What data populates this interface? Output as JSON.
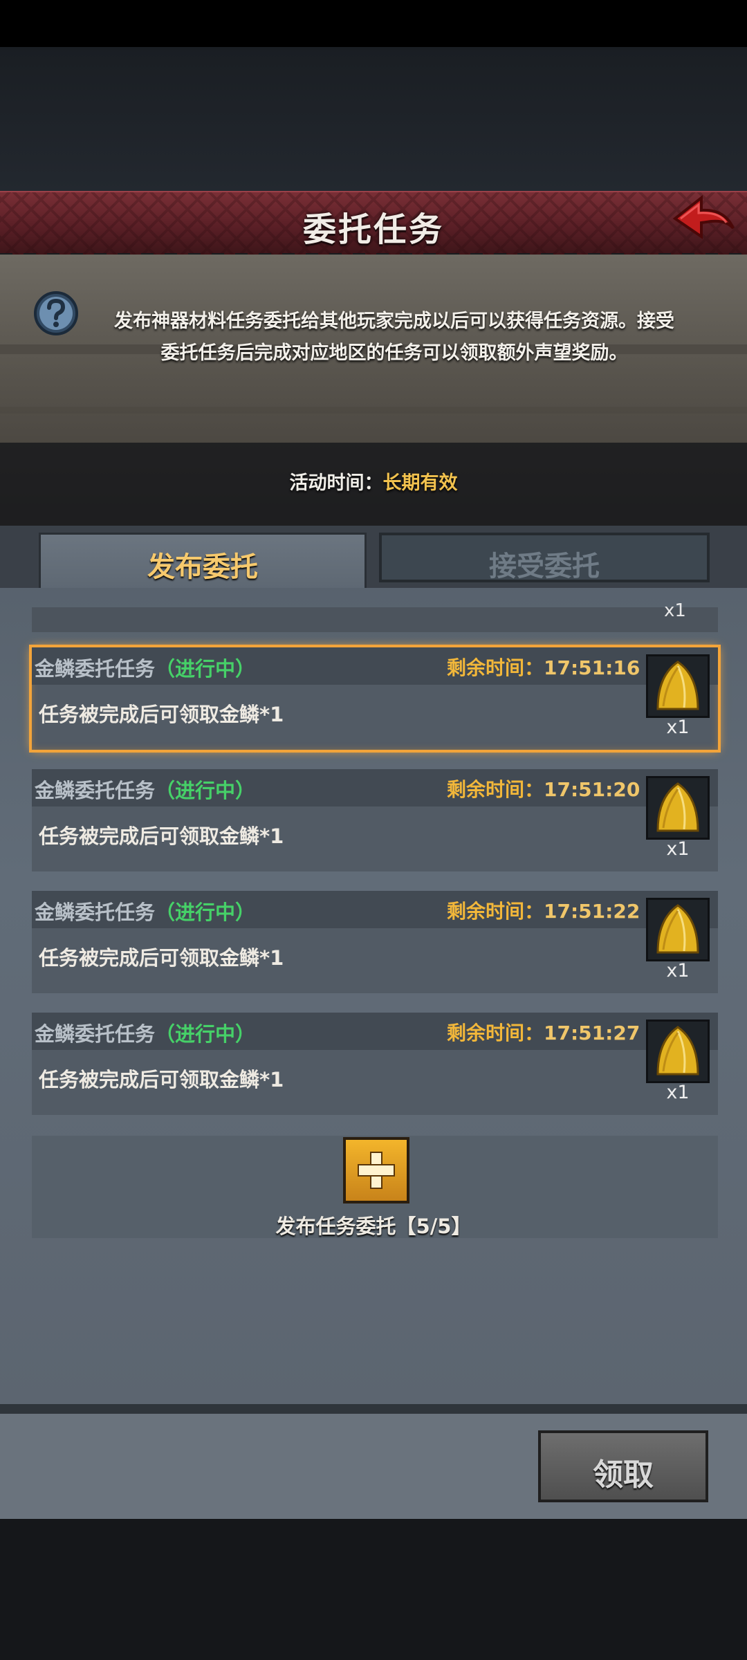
{
  "header": {
    "title": "委托任务"
  },
  "info": {
    "description_line1": "发布神器材料任务委托给其他玩家完成以后可以获得任务资源。接受",
    "description_line2": "委托任务后完成对应地区的任务可以领取额外声望奖励。",
    "activity_label": "活动时间：",
    "activity_value": "长期有效"
  },
  "tabs": [
    {
      "label": "发布委托",
      "active": true
    },
    {
      "label": "接受委托",
      "active": false
    }
  ],
  "partial_row": {
    "qty": "x1"
  },
  "tasks": [
    {
      "name": "金鳞委托任务",
      "status": "（进行中）",
      "time_label": "剩余时间：",
      "time_value": "17:51:16",
      "desc": "任务被完成后可领取金鳞*1",
      "reward_qty": "x1",
      "selected": true
    },
    {
      "name": "金鳞委托任务",
      "status": "（进行中）",
      "time_label": "剩余时间：",
      "time_value": "17:51:20",
      "desc": "任务被完成后可领取金鳞*1",
      "reward_qty": "x1",
      "selected": false
    },
    {
      "name": "金鳞委托任务",
      "status": "（进行中）",
      "time_label": "剩余时间：",
      "time_value": "17:51:22",
      "desc": "任务被完成后可领取金鳞*1",
      "reward_qty": "x1",
      "selected": false
    },
    {
      "name": "金鳞委托任务",
      "status": "（进行中）",
      "time_label": "剩余时间：",
      "time_value": "17:51:27",
      "desc": "任务被完成后可领取金鳞*1",
      "reward_qty": "x1",
      "selected": false
    }
  ],
  "publish": {
    "label": "发布任务委托【5/5】"
  },
  "footer": {
    "claim_label": "领取"
  },
  "colors": {
    "banner": "#6a2830",
    "accent_gold": "#f2c24e",
    "status_green": "#46d168",
    "panel": "#5c6570"
  },
  "icons": {
    "back": "red-arrow-back-icon",
    "help": "question-mark-icon",
    "reward": "golden-scale-icon",
    "add": "plus-icon"
  }
}
